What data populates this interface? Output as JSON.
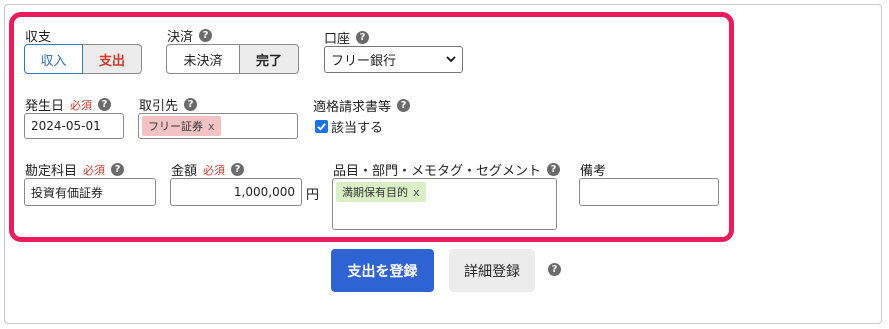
{
  "form": {
    "kind": {
      "label": "収支",
      "income": "収入",
      "expense": "支出",
      "selected": "支出"
    },
    "settlement": {
      "label": "決済",
      "unsettled": "未決済",
      "done": "完了",
      "selected": "完了"
    },
    "account": {
      "label": "口座",
      "value": "フリー銀行"
    },
    "issue_date": {
      "label": "発生日",
      "required": "必須",
      "value": "2024-05-01"
    },
    "partner": {
      "label": "取引先",
      "tag": "フリー証券",
      "remove": "x"
    },
    "invoice": {
      "label": "適格請求書等",
      "checkbox_label": "該当する",
      "checked": true
    },
    "account_item": {
      "label": "勘定科目",
      "required": "必須",
      "value": "投資有価証券"
    },
    "amount": {
      "label": "金額",
      "required": "必須",
      "value": "1,000,000",
      "unit": "円"
    },
    "items": {
      "label": "品目・部門・メモタグ・セグメント",
      "tag": "満期保有目的",
      "remove": "x"
    },
    "remarks": {
      "label": "備考",
      "value": ""
    },
    "help_glyph": "?"
  },
  "actions": {
    "register_expense": "支出を登録",
    "detail_register": "詳細登録"
  },
  "colors": {
    "highlight": "#ec1b5b",
    "primary": "#2f62d2",
    "required": "#d0392b",
    "partner_tag": "#f3c2c2",
    "items_tag": "#d9efc6"
  }
}
